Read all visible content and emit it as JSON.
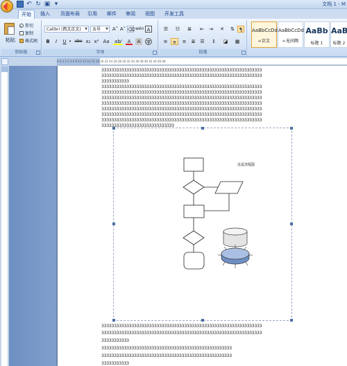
{
  "window": {
    "title": "文档 1 - M"
  },
  "tabs": [
    "开始",
    "插入",
    "页面布局",
    "引用",
    "邮件",
    "审阅",
    "视图",
    "开发工具"
  ],
  "clipboard": {
    "paste": "粘贴",
    "cut": "剪切",
    "copy": "复制",
    "format_painter": "格式刷",
    "label": "剪贴板"
  },
  "font": {
    "name": "Calibri (西文正文)",
    "size": "五号",
    "label": "字体",
    "bold": "B",
    "italic": "I",
    "underline": "U",
    "strike": "abe",
    "subscript": "x₂",
    "superscript": "x²",
    "change_case": "Aa",
    "grow": "A˄",
    "shrink": "A˅",
    "phonetic": "wén",
    "border": "A",
    "highlight": "ab⁄",
    "font_color": "A",
    "shade": "A",
    "enclosed": "字"
  },
  "paragraph": {
    "label": "段落"
  },
  "styles": [
    {
      "sample": "AaBbCcDd",
      "name": "↵正文"
    },
    {
      "sample": "AaBbCcDd",
      "name": "↵无间隔"
    },
    {
      "sample": "AaBb",
      "name": "标题 1"
    },
    {
      "sample": "AaBb",
      "name": "标题 2"
    }
  ],
  "document": {
    "lines_top": [
      "3333333333333333333333333333333333333333333333333333333333333333",
      "3333333333333333333333333333333333333333333333333333333333333333",
      "33333333333",
      "3333333333333333333333333333333333333333333333333333333333333333",
      "3333333333333333333333333333333333333333333333333333333333333333",
      "3333333333333333333333333333333333333333333333333333333333333333",
      "3333333333333333333333333333333333333333333333333333333333333333",
      "3333333333333333333333333333333333333333333333333333333333333333",
      "3333333333333333333333333333333333333333333333333333333333333333",
      "3333333333333333333333333333333333333333333333333333333333333333",
      "33333333333333333333333333333"
    ],
    "canvas_caption": "这是流程图",
    "lines_bottom": [
      "3333333333333333333333333333333333333333333333333333333333333333",
      "3333333333333333333333333333333333333333333333333333333333333333",
      "33333333333",
      "3333333333333333333333333333333333333333333333333333",
      "3333333333333333333333333333333333333333333333333333",
      "33333333333"
    ]
  },
  "ruler": {
    "ticks": "8  6  4  2     2  4  6  8  10  12  14  16  18  20  22  24  26  28  30  32  34  36  38  40  42  44  46  48"
  },
  "colors": {
    "ribbon": "#d6e4f6",
    "accent": "#15428b",
    "highlight": "#ffff00",
    "font_color": "#e02020"
  }
}
